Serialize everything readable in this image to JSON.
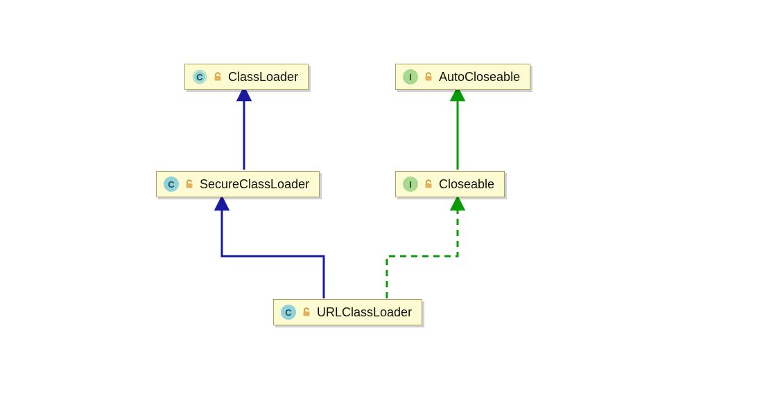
{
  "diagram": {
    "nodes": {
      "classloader": {
        "label": "ClassLoader",
        "kind_letter": "C",
        "kind": "abstract_class"
      },
      "autocloseable": {
        "label": "AutoCloseable",
        "kind_letter": "I",
        "kind": "interface"
      },
      "secureclassloader": {
        "label": "SecureClassLoader",
        "kind_letter": "C",
        "kind": "class"
      },
      "closeable": {
        "label": "Closeable",
        "kind_letter": "I",
        "kind": "interface"
      },
      "urlclassloader": {
        "label": "URLClassLoader",
        "kind_letter": "C",
        "kind": "class"
      }
    },
    "edges": [
      {
        "from": "secureclassloader",
        "to": "classloader",
        "relation": "extends"
      },
      {
        "from": "urlclassloader",
        "to": "secureclassloader",
        "relation": "extends"
      },
      {
        "from": "closeable",
        "to": "autocloseable",
        "relation": "extends_interface"
      },
      {
        "from": "urlclassloader",
        "to": "closeable",
        "relation": "implements"
      }
    ],
    "colors": {
      "extends": "#1a1a9e",
      "interface_arrow": "#0a9a0a",
      "node_fill": "#fdfbd1",
      "node_border": "#a89f63"
    }
  }
}
